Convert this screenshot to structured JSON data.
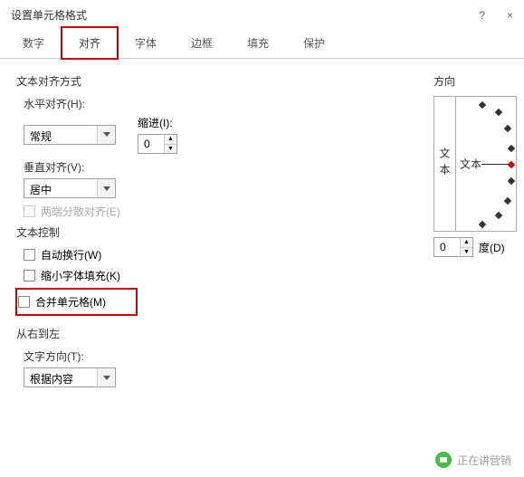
{
  "dialog": {
    "title": "设置单元格格式"
  },
  "tabs": {
    "number": "数字",
    "alignment": "对齐",
    "font": "字体",
    "border": "边框",
    "fill": "填充",
    "protect": "保护"
  },
  "align": {
    "section": "文本对齐方式",
    "h_label": "水平对齐(H):",
    "h_value": "常规",
    "indent_label": "缩进(I):",
    "indent_value": "0",
    "v_label": "垂直对齐(V):",
    "v_value": "居中",
    "justify": "两端分散对齐(E)"
  },
  "ctrl": {
    "section": "文本控制",
    "wrap": "自动换行(W)",
    "shrink": "缩小字体填充(K)",
    "merge": "合并单元格(M)"
  },
  "rtl": {
    "section": "从右到左",
    "dir_label": "文字方向(T):",
    "dir_value": "根据内容"
  },
  "orient": {
    "section": "方向",
    "vertical_text": "文本",
    "label": "文本",
    "deg_value": "0",
    "deg_unit": "度(D)"
  },
  "watermark": "正在讲营销"
}
